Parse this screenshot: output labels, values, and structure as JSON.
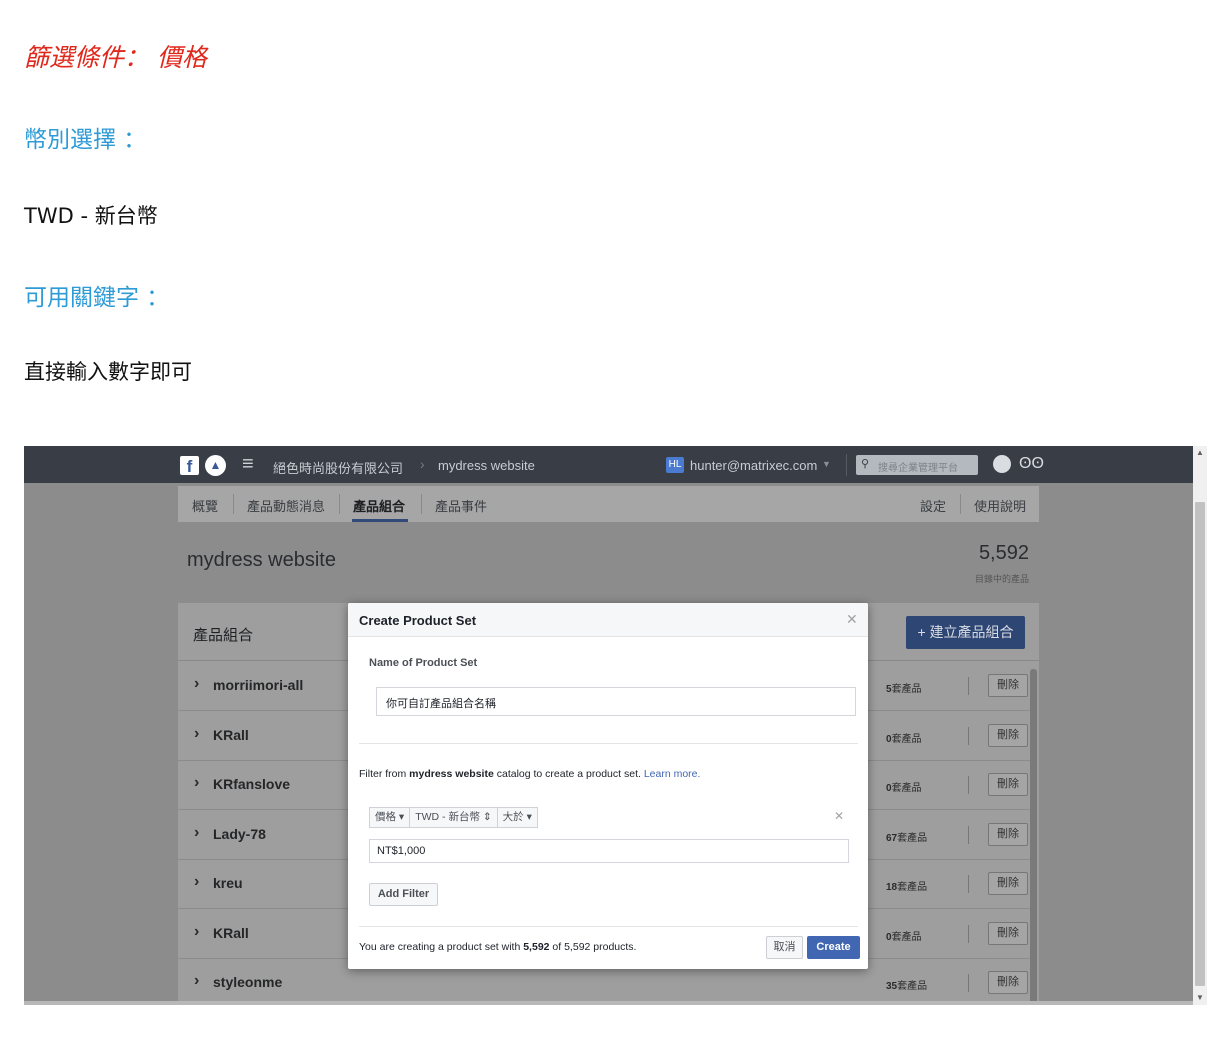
{
  "doc": {
    "filter_heading": "篩選條件： 價格",
    "currency_heading": "幣別選擇 ：",
    "currency_value": "TWD -  新台幣",
    "keyword_heading": "可用關鍵字 ：",
    "keyword_value": "直接輸入數字即可"
  },
  "topbar": {
    "company": "絕色時尚股份有限公司",
    "account": "mydress website",
    "user_badge": "HL",
    "user_email": "hunter@matrixec.com",
    "search_placeholder": "搜尋企業管理平台"
  },
  "nav": {
    "tabs": [
      {
        "label": "概覽"
      },
      {
        "label": "產品動態消息"
      },
      {
        "label": "產品組合"
      },
      {
        "label": "產品事件"
      }
    ],
    "right": [
      {
        "label": "設定"
      },
      {
        "label": "使用說明"
      }
    ]
  },
  "catalog": {
    "title": "mydress website",
    "product_count": "5,592",
    "product_count_label": "目錄中的產品"
  },
  "sets": {
    "title": "產品組合",
    "create_button": "+ 建立產品組合",
    "unit": "套產品",
    "delete_label": "刪除",
    "rows": [
      {
        "name": "morriimori-all",
        "count": "5"
      },
      {
        "name": "KRall",
        "count": "0"
      },
      {
        "name": "KRfanslove",
        "count": "0"
      },
      {
        "name": "Lady-78",
        "count": "67"
      },
      {
        "name": "kreu",
        "count": "18"
      },
      {
        "name": "KRall",
        "count": "0"
      },
      {
        "name": "styleonme",
        "count": "35"
      }
    ]
  },
  "modal": {
    "title": "Create Product Set",
    "name_label": "Name of Product Set",
    "name_value": "你可自訂產品組合名稱",
    "filter_desc_prefix": "Filter from ",
    "filter_desc_catalog": "mydress website",
    "filter_desc_suffix": " catalog to create a product set. ",
    "learn_more": "Learn more.",
    "filter_chips": [
      "價格 ▾",
      "TWD - 新台幣 ⇕",
      "大於 ▾"
    ],
    "filter_value": "NT$1,000",
    "add_filter": "Add Filter",
    "footer_prefix": "You are creating a product set with ",
    "footer_count": "5,592",
    "footer_suffix": " of 5,592 products.",
    "cancel": "取消",
    "create": "Create"
  }
}
